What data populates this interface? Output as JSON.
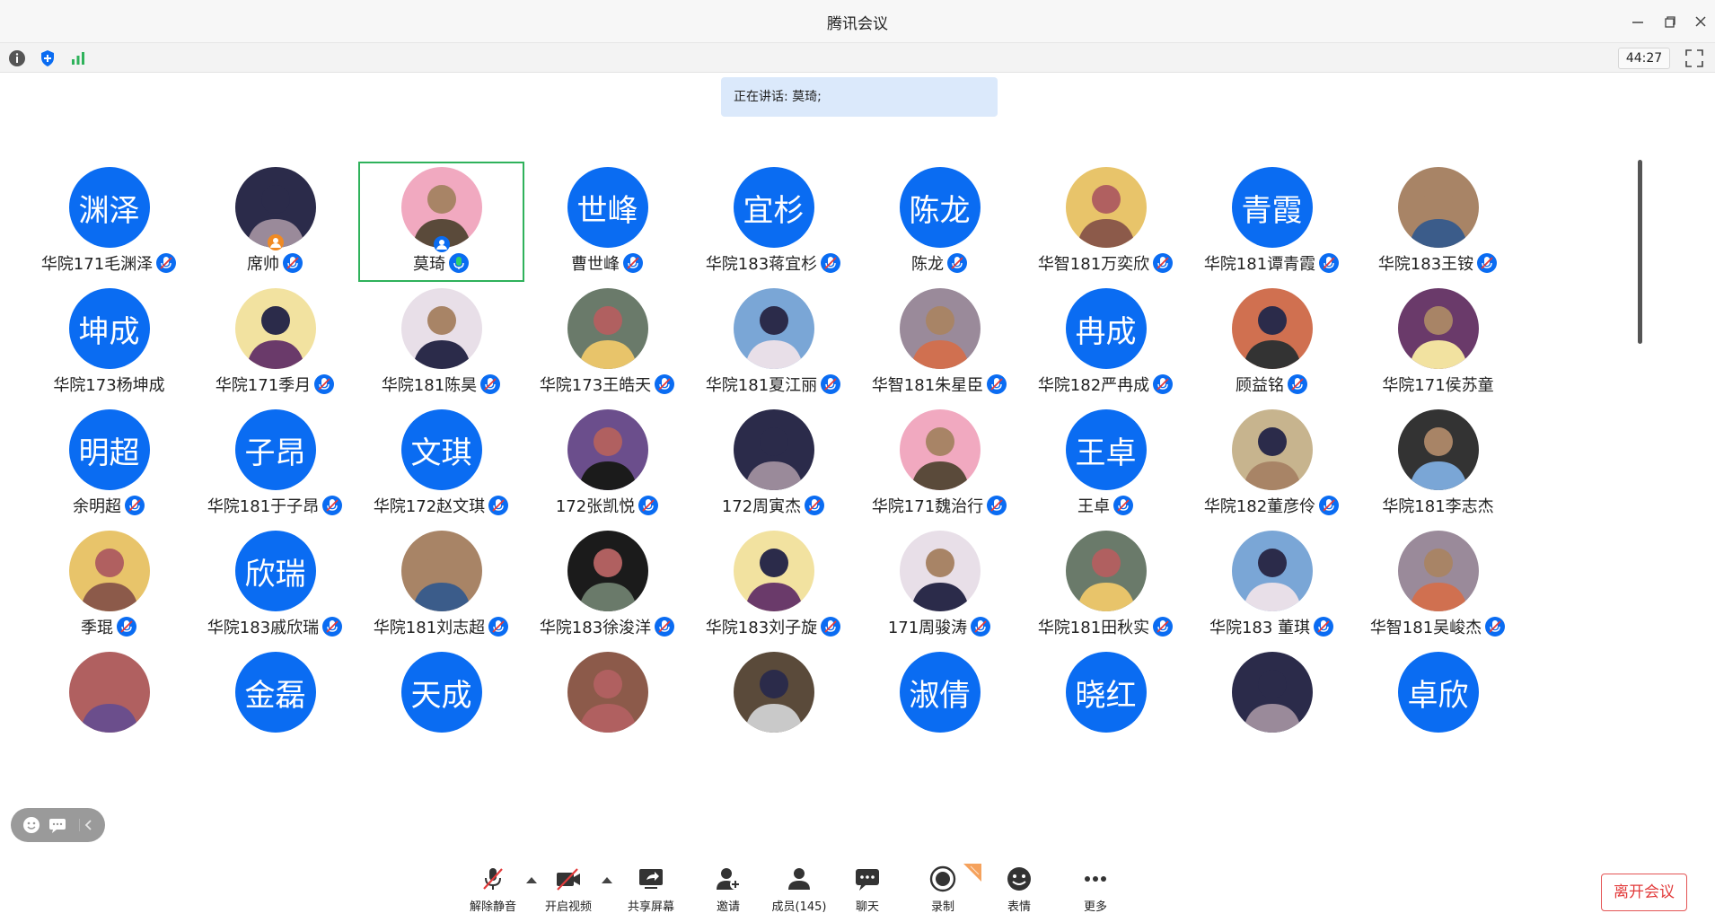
{
  "window": {
    "title": "腾讯会议"
  },
  "status": {
    "timer": "44:27"
  },
  "speaking": {
    "label": "正在讲话: 莫琦;"
  },
  "participants": [
    {
      "name": "华院171毛渊泽",
      "avatar_text": "渊泽",
      "mic": "muted"
    },
    {
      "name": "席帅",
      "avatar_text": "",
      "mic": "muted",
      "host": true
    },
    {
      "name": "莫琦",
      "avatar_text": "",
      "mic": "speaking",
      "active": true
    },
    {
      "name": "曹世峰",
      "avatar_text": "世峰",
      "mic": "muted"
    },
    {
      "name": "华院183蒋宜杉",
      "avatar_text": "宜杉",
      "mic": "muted"
    },
    {
      "name": "陈龙",
      "avatar_text": "陈龙",
      "mic": "muted"
    },
    {
      "name": "华智181万奕欣",
      "avatar_text": "",
      "mic": "muted"
    },
    {
      "name": "华院181谭青霞",
      "avatar_text": "青霞",
      "mic": "muted"
    },
    {
      "name": "华院183王铵",
      "avatar_text": "",
      "mic": "muted"
    },
    {
      "name": "华院173杨坤成",
      "avatar_text": "坤成",
      "mic": "none"
    },
    {
      "name": "华院171季月",
      "avatar_text": "",
      "mic": "muted"
    },
    {
      "name": "华院181陈昊",
      "avatar_text": "",
      "mic": "muted"
    },
    {
      "name": "华院173王皓天",
      "avatar_text": "",
      "mic": "muted"
    },
    {
      "name": "华院181夏江丽",
      "avatar_text": "",
      "mic": "muted"
    },
    {
      "name": "华智181朱星臣",
      "avatar_text": "",
      "mic": "muted"
    },
    {
      "name": "华院182严冉成",
      "avatar_text": "冉成",
      "mic": "muted"
    },
    {
      "name": "顾益铭",
      "avatar_text": "",
      "mic": "muted"
    },
    {
      "name": "华院171侯苏童",
      "avatar_text": "",
      "mic": "none"
    },
    {
      "name": "余明超",
      "avatar_text": "明超",
      "mic": "muted"
    },
    {
      "name": "华院181于子昂",
      "avatar_text": "子昂",
      "mic": "muted"
    },
    {
      "name": "华院172赵文琪",
      "avatar_text": "文琪",
      "mic": "muted"
    },
    {
      "name": "172张凯悦",
      "avatar_text": "",
      "mic": "muted"
    },
    {
      "name": "172周寅杰",
      "avatar_text": "",
      "mic": "muted"
    },
    {
      "name": "华院171魏治行",
      "avatar_text": "",
      "mic": "muted"
    },
    {
      "name": "王卓",
      "avatar_text": "王卓",
      "mic": "muted"
    },
    {
      "name": "华院182董彦伶",
      "avatar_text": "",
      "mic": "muted"
    },
    {
      "name": "华院181李志杰",
      "avatar_text": "",
      "mic": "none"
    },
    {
      "name": "季琨",
      "avatar_text": "",
      "mic": "muted"
    },
    {
      "name": "华院183戚欣瑞",
      "avatar_text": "欣瑞",
      "mic": "muted"
    },
    {
      "name": "华院181刘志超",
      "avatar_text": "",
      "mic": "muted"
    },
    {
      "name": "华院183徐浚洋",
      "avatar_text": "",
      "mic": "muted"
    },
    {
      "name": "华院183刘子旋",
      "avatar_text": "",
      "mic": "muted"
    },
    {
      "name": "171周骏涛",
      "avatar_text": "",
      "mic": "muted"
    },
    {
      "name": "华院181田秋实",
      "avatar_text": "",
      "mic": "muted"
    },
    {
      "name": "华院183 董琪",
      "avatar_text": "",
      "mic": "muted"
    },
    {
      "name": "华智181吴峻杰",
      "avatar_text": "",
      "mic": "muted"
    },
    {
      "name": "",
      "avatar_text": "",
      "mic": "none"
    },
    {
      "name": "",
      "avatar_text": "金磊",
      "mic": "none"
    },
    {
      "name": "",
      "avatar_text": "天成",
      "mic": "none"
    },
    {
      "name": "",
      "avatar_text": "",
      "mic": "none"
    },
    {
      "name": "",
      "avatar_text": "",
      "mic": "none"
    },
    {
      "name": "",
      "avatar_text": "淑倩",
      "mic": "none"
    },
    {
      "name": "",
      "avatar_text": "晓红",
      "mic": "none"
    },
    {
      "name": "",
      "avatar_text": "",
      "mic": "none"
    },
    {
      "name": "",
      "avatar_text": "卓欣",
      "mic": "none"
    }
  ],
  "toolbar": {
    "unmute": "解除静音",
    "video": "开启视频",
    "share": "共享屏幕",
    "invite": "邀请",
    "members": "成员(145)",
    "chat": "聊天",
    "record": "录制",
    "reaction": "表情",
    "more": "更多",
    "leave": "离开会议"
  },
  "colors": {
    "accent": "#0a6cf2",
    "speaking_bg": "#dbe9fb",
    "active_border": "#2fb25b",
    "leave": "#e23b3b"
  }
}
